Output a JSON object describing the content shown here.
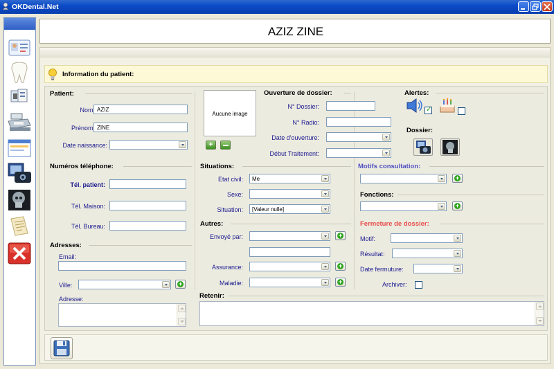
{
  "window": {
    "title": "OKDental.Net"
  },
  "header": {
    "patient_name": "AZIZ ZINE"
  },
  "info": {
    "title": "Information du patient:"
  },
  "patient": {
    "section": "Patient:",
    "nom_label": "Nom:",
    "nom_value": "AZIZ",
    "prenom_label": "Prénom:",
    "prenom_value": "ZINE",
    "date_naissance_label": "Date naissance:",
    "date_naissance_value": ""
  },
  "telephone": {
    "section": "Numéros téléphone:",
    "patient_label": "Tél. patient:",
    "maison_label": "Tél. Maison:",
    "bureau_label": "Tél. Bureau:"
  },
  "adresses": {
    "section": "Adresses:",
    "email_label": "Email:",
    "ville_label": "Ville:",
    "adresse_label": "Adresse:"
  },
  "photo": {
    "placeholder": "Aucune image"
  },
  "ouverture": {
    "section": "Ouverture de dossier:",
    "dossier_label": "N° Dossier:",
    "radio_label": "N° Radio:",
    "date_label": "Date d'ouverture:",
    "debut_label": "Début Traitement:"
  },
  "alertes": {
    "section": "Alertes:",
    "sound_checked": true,
    "birthday_checked": false
  },
  "dossier": {
    "section": "Dossier:"
  },
  "situations": {
    "section": "Situations:",
    "etat_civil_label": "Etat civil:",
    "etat_civil_value": "Me",
    "sexe_label": "Sexe:",
    "sexe_value": "",
    "situation_label": "Situation:",
    "situation_value": "[Valeur nulle]"
  },
  "autres": {
    "section": "Autres:",
    "envoye_label": "Envoyé par:",
    "assurance_label": "Assurance:",
    "maladie_label": "Maladie:"
  },
  "motifs": {
    "section": "Motifs consultation:"
  },
  "fonctions": {
    "section": "Fonctions:"
  },
  "fermeture": {
    "section": "Fermeture de dossier:",
    "motif_label": "Motif:",
    "resultat_label": "Résultat:",
    "date_label": "Date fermuture:",
    "archiver_label": "Archiver:",
    "archiver_checked": false
  },
  "retenir": {
    "section": "Retenir:"
  },
  "sidebar": {
    "items": [
      "patient-card-icon",
      "tooth-icon",
      "documents-icon",
      "cash-register-icon",
      "window-icon",
      "camera-icon",
      "xray-icon",
      "notes-icon",
      "close-icon"
    ]
  }
}
